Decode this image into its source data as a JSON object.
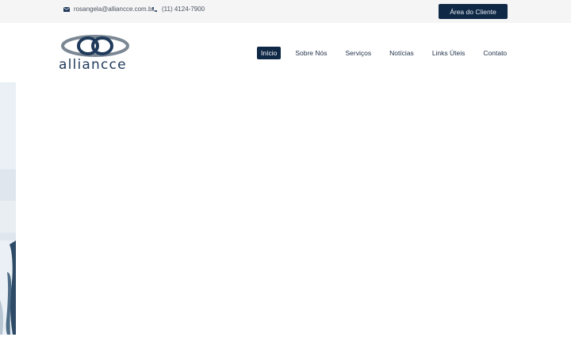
{
  "topbar": {
    "email": "rosangela@alliancce.com.br",
    "phone": "(11) 4124-7900",
    "client_button": "Área do Cliente",
    "icons": {
      "email": "envelope-icon",
      "phone": "phone-icon"
    }
  },
  "logo": {
    "text": "alliancce",
    "icon": "interlocking-rings-logo"
  },
  "nav": {
    "items": [
      {
        "label": "Início",
        "active": true
      },
      {
        "label": "Sobre Nós",
        "active": false
      },
      {
        "label": "Serviços",
        "active": false
      },
      {
        "label": "Notícias",
        "active": false
      },
      {
        "label": "Links Úteis",
        "active": false
      },
      {
        "label": "Contato",
        "active": false
      }
    ]
  },
  "colors": {
    "accent": "#0f2846",
    "topbar_bg": "#f5f5f5",
    "logo_primary": "#1f3a5a",
    "logo_secondary": "#7b8794"
  }
}
